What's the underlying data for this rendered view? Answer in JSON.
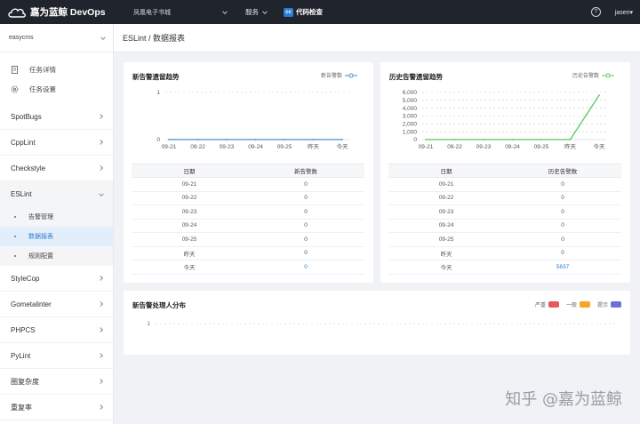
{
  "topbar": {
    "brand": "嘉为蓝鲸 DevOps",
    "project": "凤凰电子书城",
    "nav": [
      {
        "label": "服务"
      },
      {
        "label": "代码检查",
        "badge": "cc"
      }
    ],
    "help": "?",
    "user": "jasen"
  },
  "sidebar": {
    "project": "easycms",
    "task_links": [
      {
        "label": "任务详情",
        "icon": "document-icon"
      },
      {
        "label": "任务设置",
        "icon": "gear-icon"
      }
    ],
    "groups_before": [
      "SpotBugs",
      "CppLint",
      "Checkstyle"
    ],
    "open_group": {
      "label": "ESLint",
      "children": [
        "告警管理",
        "数据报表",
        "规则配置"
      ],
      "active_index": 1
    },
    "groups_after": [
      "StyleCop",
      "Gometalinter",
      "PHPCS",
      "PyLint",
      "圈复杂度",
      "重复率"
    ]
  },
  "breadcrumb": "ESLint / 数据报表",
  "new_alerts": {
    "title": "新告警遗留趋势",
    "legend": "新告警数",
    "table_headers": [
      "日期",
      "新告警数"
    ],
    "color": "#4a8bd6",
    "chart_data": {
      "type": "line",
      "title": "新告警遗留趋势",
      "categories": [
        "09-21",
        "09-22",
        "09-23",
        "09-24",
        "09-25",
        "昨天",
        "今天"
      ],
      "series": [
        {
          "name": "新告警数",
          "values": [
            0,
            0,
            0,
            0,
            0,
            0,
            0
          ]
        }
      ],
      "y_ticks": [
        "0",
        "1"
      ],
      "ylim": [
        0,
        1
      ],
      "grid": true,
      "legend": "top-right"
    },
    "rows": [
      {
        "date": "09-21",
        "value": "0"
      },
      {
        "date": "09-22",
        "value": "0"
      },
      {
        "date": "09-23",
        "value": "0"
      },
      {
        "date": "09-24",
        "value": "0"
      },
      {
        "date": "09-25",
        "value": "0"
      },
      {
        "date": "昨天",
        "value": "0"
      },
      {
        "date": "今天",
        "value": "0"
      }
    ]
  },
  "history_alerts": {
    "title": "历史告警遗留趋势",
    "legend": "历史告警数",
    "table_headers": [
      "日期",
      "历史告警数"
    ],
    "color": "#52c95a",
    "chart_data": {
      "type": "line",
      "title": "历史告警遗留趋势",
      "categories": [
        "09-21",
        "09-22",
        "09-23",
        "09-24",
        "09-25",
        "昨天",
        "今天"
      ],
      "series": [
        {
          "name": "历史告警数",
          "values": [
            0,
            0,
            0,
            0,
            0,
            0,
            5637
          ]
        }
      ],
      "y_ticks": [
        "0",
        "1,000",
        "2,000",
        "3,000",
        "4,000",
        "5,000",
        "6,000"
      ],
      "ylim": [
        0,
        6000
      ],
      "grid": true,
      "legend": "top-right"
    },
    "rows": [
      {
        "date": "09-21",
        "value": "0"
      },
      {
        "date": "09-22",
        "value": "0"
      },
      {
        "date": "09-23",
        "value": "0"
      },
      {
        "date": "09-24",
        "value": "0"
      },
      {
        "date": "09-25",
        "value": "0"
      },
      {
        "date": "昨天",
        "value": "0"
      },
      {
        "date": "今天",
        "value": "5637"
      }
    ]
  },
  "owner_dist": {
    "title": "新告警处理人分布",
    "legend": [
      {
        "label": "严重",
        "color": "#e8575b"
      },
      {
        "label": "一般",
        "color": "#f5a623"
      },
      {
        "label": "提示",
        "color": "#6f6fd8"
      }
    ],
    "y_tick": "1"
  },
  "watermark": "知乎 @嘉为蓝鲸"
}
